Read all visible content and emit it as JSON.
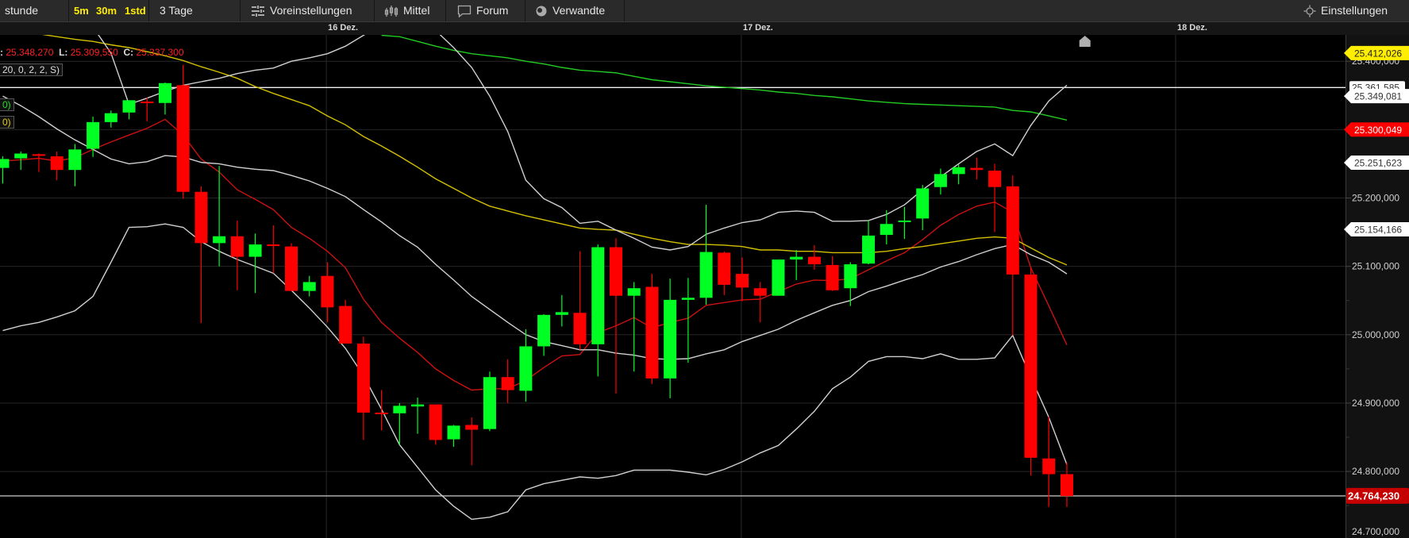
{
  "toolbar": {
    "interval_label": "stunde",
    "quick_intervals": [
      "5m",
      "30m",
      "1std"
    ],
    "range": "3 Tage",
    "presets": "Voreinstellungen",
    "averages": "Mittel",
    "forum": "Forum",
    "related": "Verwandte",
    "settings": "Einstellungen",
    "icons": {
      "presets": "sliders-icon",
      "averages": "candlestick-icon",
      "forum": "speech-bubble-icon",
      "related": "circle-icon",
      "settings": "gear-icon"
    }
  },
  "legend": {
    "h_prefix": ":",
    "h_value": "25.348,270",
    "l_label": "L:",
    "l_value": "25.309,550",
    "c_label": "C:",
    "c_value": "25.337,300",
    "bollinger_params": "20, 0, 2, 2, S)",
    "green_ma_params": "0)",
    "yellow_ma_params": "0)"
  },
  "colors": {
    "up": "#00ff22",
    "down": "#ff0000",
    "short_ma": "#cc1111",
    "mid_ma": "#d4c000",
    "long_ma": "#22cc22",
    "bands": "#d0d0d0",
    "background": "#000000"
  },
  "chart_data": {
    "type": "candlestick",
    "interval": "1std",
    "ylim": [
      24690,
      25445
    ],
    "grid": true,
    "y_ticks": [
      "25.400,000",
      "25.300,000",
      "25.200,000",
      "25.100,000",
      "25.000,000",
      "24.900,000",
      "24.800,000",
      "24.700,000"
    ],
    "y_tick_values": [
      25400,
      25300,
      25200,
      25100,
      25000,
      24900,
      24800,
      24700
    ],
    "date_labels": [
      {
        "label": "16 Dez.",
        "index": 17.94
      },
      {
        "label": "17 Dez.",
        "index": 40.95
      },
      {
        "label": "18 Dez.",
        "index": 65.03
      }
    ],
    "candles": [
      {
        "o": 25244,
        "h": 25261,
        "l": 25221,
        "c": 25257
      },
      {
        "o": 25258,
        "h": 25268,
        "l": 25241,
        "c": 25265
      },
      {
        "o": 25264,
        "h": 25265,
        "l": 25238,
        "c": 25262
      },
      {
        "o": 25261,
        "h": 25268,
        "l": 25226,
        "c": 25241
      },
      {
        "o": 25241,
        "h": 25279,
        "l": 25217,
        "c": 25271
      },
      {
        "o": 25272,
        "h": 25319,
        "l": 25260,
        "c": 25311
      },
      {
        "o": 25311,
        "h": 25328,
        "l": 25303,
        "c": 25324
      },
      {
        "o": 25325,
        "h": 25343,
        "l": 25315,
        "c": 25343
      },
      {
        "o": 25341,
        "h": 25347,
        "l": 25312,
        "c": 25339
      },
      {
        "o": 25339,
        "h": 25369,
        "l": 25322,
        "c": 25368
      },
      {
        "o": 25365,
        "h": 25395,
        "l": 25199,
        "c": 25209
      },
      {
        "o": 25209,
        "h": 25217,
        "l": 25017,
        "c": 25134
      },
      {
        "o": 25134,
        "h": 25247,
        "l": 25100,
        "c": 25144
      },
      {
        "o": 25144,
        "h": 25167,
        "l": 25065,
        "c": 25114
      },
      {
        "o": 25114,
        "h": 25148,
        "l": 25061,
        "c": 25132
      },
      {
        "o": 25132,
        "h": 25160,
        "l": 25090,
        "c": 25131
      },
      {
        "o": 25129,
        "h": 25134,
        "l": 25064,
        "c": 25064
      },
      {
        "o": 25064,
        "h": 25086,
        "l": 25056,
        "c": 25077
      },
      {
        "o": 25086,
        "h": 25106,
        "l": 25018,
        "c": 25040
      },
      {
        "o": 25042,
        "h": 25051,
        "l": 24987,
        "c": 24987
      },
      {
        "o": 24987,
        "h": 24997,
        "l": 24846,
        "c": 24886
      },
      {
        "o": 24886,
        "h": 24919,
        "l": 24860,
        "c": 24884
      },
      {
        "o": 24885,
        "h": 24900,
        "l": 24839,
        "c": 24896
      },
      {
        "o": 24895,
        "h": 24908,
        "l": 24855,
        "c": 24898
      },
      {
        "o": 24898,
        "h": 24898,
        "l": 24839,
        "c": 24846
      },
      {
        "o": 24847,
        "h": 24868,
        "l": 24836,
        "c": 24867
      },
      {
        "o": 24868,
        "h": 24879,
        "l": 24809,
        "c": 24861
      },
      {
        "o": 24862,
        "h": 24946,
        "l": 24859,
        "c": 24938
      },
      {
        "o": 24938,
        "h": 24964,
        "l": 24900,
        "c": 24919
      },
      {
        "o": 24918,
        "h": 25008,
        "l": 24902,
        "c": 24983
      },
      {
        "o": 24983,
        "h": 25030,
        "l": 24969,
        "c": 25029
      },
      {
        "o": 25029,
        "h": 25058,
        "l": 25012,
        "c": 25033
      },
      {
        "o": 25032,
        "h": 25122,
        "l": 24978,
        "c": 24986
      },
      {
        "o": 24986,
        "h": 25132,
        "l": 24939,
        "c": 25128
      },
      {
        "o": 25128,
        "h": 25141,
        "l": 24914,
        "c": 25057
      },
      {
        "o": 25057,
        "h": 25077,
        "l": 24946,
        "c": 25068
      },
      {
        "o": 25070,
        "h": 25089,
        "l": 24928,
        "c": 24936
      },
      {
        "o": 24936,
        "h": 25082,
        "l": 24907,
        "c": 25051
      },
      {
        "o": 25051,
        "h": 25083,
        "l": 24959,
        "c": 25054
      },
      {
        "o": 25054,
        "h": 25190,
        "l": 25044,
        "c": 25121
      },
      {
        "o": 25120,
        "h": 25122,
        "l": 25058,
        "c": 25073
      },
      {
        "o": 25089,
        "h": 25113,
        "l": 25049,
        "c": 25069
      },
      {
        "o": 25068,
        "h": 25077,
        "l": 25018,
        "c": 25057
      },
      {
        "o": 25057,
        "h": 25110,
        "l": 25057,
        "c": 25110
      },
      {
        "o": 25110,
        "h": 25124,
        "l": 25080,
        "c": 25114
      },
      {
        "o": 25114,
        "h": 25131,
        "l": 25095,
        "c": 25103
      },
      {
        "o": 25102,
        "h": 25115,
        "l": 25064,
        "c": 25065
      },
      {
        "o": 25068,
        "h": 25106,
        "l": 25042,
        "c": 25103
      },
      {
        "o": 25104,
        "h": 25167,
        "l": 25103,
        "c": 25145
      },
      {
        "o": 25146,
        "h": 25182,
        "l": 25132,
        "c": 25162
      },
      {
        "o": 25165,
        "h": 25187,
        "l": 25140,
        "c": 25167
      },
      {
        "o": 25170,
        "h": 25219,
        "l": 25153,
        "c": 25214
      },
      {
        "o": 25216,
        "h": 25243,
        "l": 25205,
        "c": 25235
      },
      {
        "o": 25235,
        "h": 25249,
        "l": 25220,
        "c": 25245
      },
      {
        "o": 25244,
        "h": 25259,
        "l": 25227,
        "c": 25241
      },
      {
        "o": 25240,
        "h": 25250,
        "l": 25150,
        "c": 25216
      },
      {
        "o": 25217,
        "h": 25233,
        "l": 24999,
        "c": 25088
      },
      {
        "o": 25088,
        "h": 25099,
        "l": 24794,
        "c": 24820
      },
      {
        "o": 24819,
        "h": 24880,
        "l": 24748,
        "c": 24796
      },
      {
        "o": 24796,
        "h": 24813,
        "l": 24748,
        "c": 24764
      }
    ],
    "indicators": [
      {
        "key": "short_ma",
        "start": 0,
        "values": [
          25254,
          25256,
          25258,
          25254,
          25259,
          25271,
          25282,
          25292,
          25302,
          25315,
          25292,
          25257,
          25238,
          25212,
          25198,
          25183,
          25157,
          25141,
          25122,
          25098,
          25052,
          25018,
          24995,
          24974,
          24950,
          24933,
          24919,
          24921,
          24921,
          24933,
          24952,
          24969,
          24971,
          25003,
          25013,
          25025,
          25010,
          25018,
          25024,
          25043,
          25047,
          25051,
          25052,
          25063,
          25074,
          25080,
          25079,
          25082,
          25095,
          25108,
          25120,
          25139,
          25160,
          25176,
          25188,
          25194,
          25179,
          25098,
          25042,
          24985
        ]
      },
      {
        "key": "mid_ma",
        "start": 2,
        "values": [
          25440,
          25436,
          25432,
          25429,
          25424,
          25420,
          25414,
          25408,
          25401,
          25392,
          25384,
          25375,
          25363,
          25353,
          25344,
          25335,
          25320,
          25307,
          25290,
          25276,
          25261,
          25245,
          25228,
          25214,
          25200,
          25188,
          25181,
          25174,
          25168,
          25162,
          25156,
          25154,
          25153,
          25147,
          25141,
          25136,
          25132,
          25132,
          25131,
          25129,
          25124,
          25124,
          25122,
          25122,
          25120,
          25120,
          25120,
          25122,
          25126,
          25129,
          25133,
          25137,
          25141,
          25143,
          25141,
          25127,
          25113,
          25102
        ]
      },
      {
        "key": "long_ma",
        "start": 21,
        "values": [
          25438,
          25436,
          25429,
          25422,
          25416,
          25411,
          25408,
          25405,
          25400,
          25396,
          25391,
          25387,
          25385,
          25383,
          25378,
          25373,
          25370,
          25367,
          25364,
          25362,
          25360,
          25358,
          25355,
          25353,
          25350,
          25348,
          25345,
          25342,
          25340,
          25338,
          25337,
          25336,
          25335,
          25334,
          25333,
          25328,
          25326,
          25320,
          25314
        ]
      },
      {
        "key": "bands",
        "start": 5,
        "values": [
          25450,
          25412,
          25337,
          25346,
          25356,
          25365,
          25370,
          25375,
          25382,
          25387,
          25390,
          25400,
          25405,
          25411,
          25422,
          25438,
          25455,
          25465,
          25460,
          25445,
          25420,
          25391,
          25349,
          25297,
          25226,
          25199,
          25186,
          25163,
          25166,
          25153,
          25141,
          25128,
          25124,
          25129,
          25147,
          25156,
          25164,
          25168,
          25179,
          25181,
          25179,
          25166,
          25166,
          25167,
          25176,
          25190,
          25212,
          25231,
          25250,
          25268,
          25279,
          25262,
          25306,
          25342,
          25365
        ]
      },
      {
        "key": "bands",
        "start": 0,
        "values": [
          25349,
          25335,
          25319,
          25301,
          25285,
          25271,
          25257,
          25250,
          25253,
          25262,
          25260,
          25252,
          25250,
          25245,
          25242,
          25240,
          25233,
          25225,
          25214,
          25202,
          25183,
          25165,
          25145,
          25128,
          25103,
          25080,
          25056,
          25037,
          25018,
          25000,
          24990,
          24984,
          24978,
          24978,
          24973,
          24970,
          24965,
          24964,
          24965,
          24972,
          24978,
          24990,
          24999,
          25008,
          25021,
          25032,
          25043,
          25050,
          25063,
          25071,
          25080,
          25088,
          25099,
          25107,
          25117,
          25126,
          25132,
          25117,
          25106,
          25089
        ]
      },
      {
        "key": "bands",
        "start": 0,
        "values": [
          25006,
          25013,
          25018,
          25026,
          25035,
          25056,
          25106,
          25157,
          25158,
          25162,
          25157,
          25136,
          25122,
          25110,
          25100,
          25090,
          25065,
          25039,
          25011,
          24980,
          24940,
          24891,
          24839,
          24806,
          24773,
          24749,
          24730,
          24733,
          24741,
          24773,
          24782,
          24787,
          24792,
          24790,
          24794,
          24802,
          24802,
          24802,
          24799,
          24795,
          24803,
          24814,
          24827,
          24838,
          24862,
          24888,
          24921,
          24938,
          24961,
          24968,
          24968,
          24965,
          24972,
          24964,
          24964,
          24966,
          24999,
          24938,
          24879,
          24810
        ]
      }
    ],
    "horizontal_lines": [
      {
        "value": 25361.585,
        "label": "25.361,585"
      },
      {
        "value": 24764.23,
        "label": "24.764,230"
      }
    ],
    "price_tags": [
      {
        "value": 25412.026,
        "label": "25.412,026",
        "bg": "#ffee00",
        "fg": "#222222",
        "shape": "arrow"
      },
      {
        "value": 25349.081,
        "label": "25.349,081",
        "bg": "#ffffff",
        "fg": "#333333",
        "shape": "arrow"
      },
      {
        "value": 25300.049,
        "label": "25.300,049",
        "bg": "#ff0000",
        "fg": "#ffffff",
        "shape": "arrow"
      },
      {
        "value": 25251.623,
        "label": "25.251,623",
        "bg": "#ffffff",
        "fg": "#333333",
        "shape": "arrow"
      },
      {
        "value": 25154.166,
        "label": "25.154,166",
        "bg": "#ffffff",
        "fg": "#333333",
        "shape": "arrow"
      },
      {
        "value": 24764.23,
        "label": "24.764,230",
        "bg": "#c40000",
        "fg": "#ffffff",
        "shape": "box"
      }
    ],
    "marker_index": 60.0
  }
}
